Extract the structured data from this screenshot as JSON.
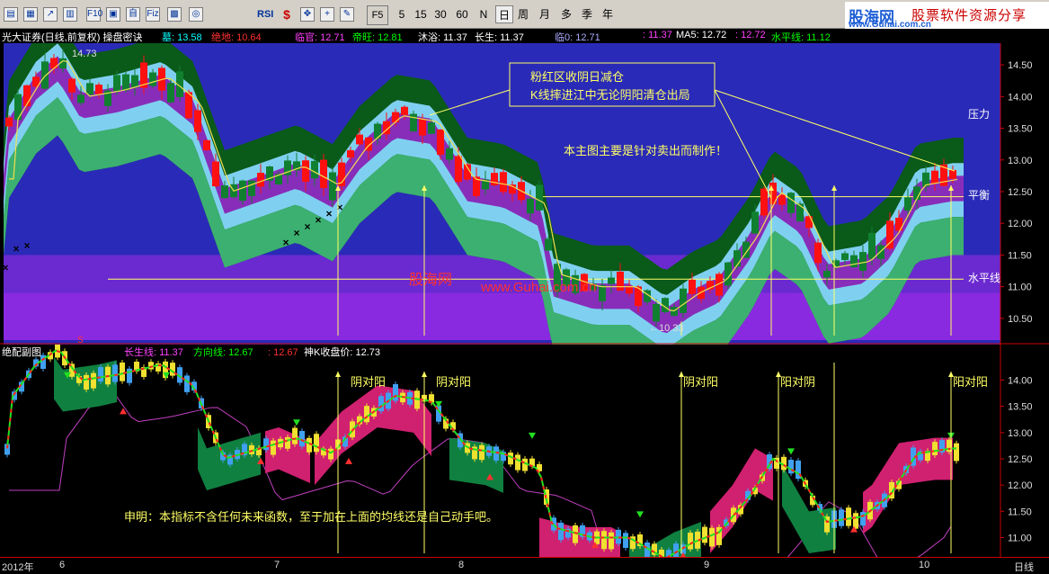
{
  "toolbar": {
    "icon_buttons": [
      {
        "name": "toolbar-icon-1",
        "glyph": "▤"
      },
      {
        "name": "toolbar-icon-2",
        "glyph": "▦"
      },
      {
        "name": "toolbar-icon-3",
        "glyph": "↗"
      },
      {
        "name": "toolbar-icon-4",
        "glyph": "▥"
      },
      {
        "name": "toolbar-icon-5",
        "glyph": "F10"
      },
      {
        "name": "toolbar-icon-6",
        "glyph": "▣"
      },
      {
        "name": "toolbar-icon-7",
        "glyph": "自"
      },
      {
        "name": "toolbar-icon-8",
        "glyph": "Fiz"
      },
      {
        "name": "toolbar-icon-9",
        "glyph": "▩"
      },
      {
        "name": "toolbar-icon-10",
        "glyph": "◎"
      }
    ],
    "indicator_rsi": "RSI",
    "indicator_s": "$",
    "f5": "F5",
    "periods": [
      "5",
      "15",
      "30",
      "60",
      "N",
      "日",
      "周",
      "月",
      "多",
      "季",
      "年"
    ],
    "active_period": "日"
  },
  "brand": {
    "logo": "股海网",
    "slogan": "股票软件资源分享",
    "url": "www.Guhai.com.cn"
  },
  "infobar": {
    "title": "光大证券(日线,前复权) 操盘密诀",
    "items": [
      {
        "label": "墓:",
        "value": "13.58",
        "color": "#00ffff"
      },
      {
        "label": "绝地:",
        "value": "10.64",
        "color": "#ff3030"
      },
      {
        "label": "临官:",
        "value": "12.71",
        "color": "#ff40ff"
      },
      {
        "label": "帝旺:",
        "value": "12.81",
        "color": "#00ff00"
      },
      {
        "label": "沐浴:",
        "value": "11.37",
        "color": "#ffffff"
      },
      {
        "label": "长生:",
        "value": "11.37",
        "color": "#ffffff"
      },
      {
        "label": "临0:",
        "value": "12.71",
        "color": "#aaaaff"
      },
      {
        "label": ":",
        "value": "11.37",
        "color": "#ff40ff"
      },
      {
        "label": "MA5:",
        "value": "12.72",
        "color": "#ffffff"
      },
      {
        "label": ":",
        "value": "12.72",
        "color": "#ff40ff"
      },
      {
        "label": "水平线:",
        "value": "11.12",
        "color": "#00ff00"
      }
    ]
  },
  "main_chart": {
    "y_labels": [
      "14.50",
      "14.00",
      "13.50",
      "13.00",
      "12.50",
      "12.00",
      "11.50",
      "11.00",
      "10.50"
    ],
    "high_label": "14.73",
    "low_label": "←10.33",
    "line_labels": {
      "pressure": "压力",
      "balance": "平衡",
      "horizontal": "水平线"
    },
    "note_box": [
      "粉红区收阴日减仓",
      "K线摔进江中无论阴阳清仓出局"
    ],
    "center_note": "本主图主要是针对卖出而制作！",
    "watermark": "股海网",
    "watermark_url": "www.Guhai.com.cn",
    "s_marker": "S"
  },
  "sub_chart": {
    "title": "绝配副图",
    "items": [
      {
        "label": "长生线:",
        "value": "11.37",
        "color": "#ff40ff"
      },
      {
        "label": "方向线:",
        "value": "12.67",
        "color": "#00ff00"
      },
      {
        "label": ":",
        "value": "12.67",
        "color": "#ff3030"
      },
      {
        "label": "神K收盘价:",
        "value": "12.73",
        "color": "#ffffff"
      }
    ],
    "y_labels": [
      "14.00",
      "13.50",
      "13.00",
      "12.50",
      "12.00",
      "11.50",
      "11.00"
    ],
    "annotations": [
      "阴对阳",
      "阴对阳",
      "阴对阳",
      "阳对阴",
      "阳对阳"
    ],
    "statement": "申明：本指标不含任何未来函数，至于加在上面的均线还是自己动手吧。"
  },
  "bottom_axis": {
    "year": "2012年",
    "months": [
      "6",
      "7",
      "8",
      "9",
      "10"
    ],
    "period_label": "日线"
  },
  "colors": {
    "up": "#ff2020",
    "down": "#00c0c0",
    "yellow": "#ffff00",
    "cyan": "#00ffff",
    "magenta": "#ff40ff"
  }
}
